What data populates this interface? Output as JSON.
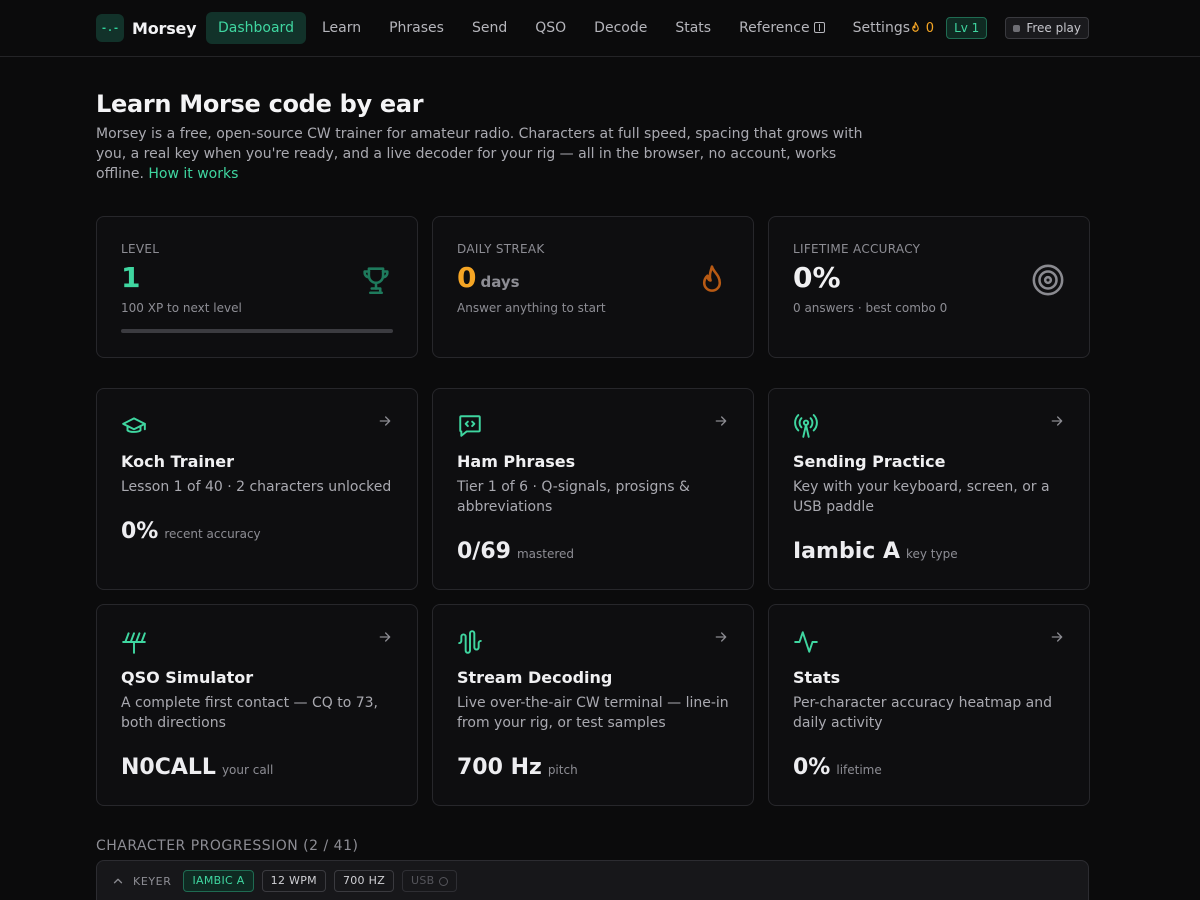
{
  "brand": {
    "logo": "-.-",
    "name": "Morsey"
  },
  "nav": {
    "items": [
      {
        "label": "Dashboard",
        "active": true
      },
      {
        "label": "Learn"
      },
      {
        "label": "Phrases"
      },
      {
        "label": "Send"
      },
      {
        "label": "QSO"
      },
      {
        "label": "Decode"
      },
      {
        "label": "Stats"
      },
      {
        "label": "Reference",
        "icon": "panel-icon"
      },
      {
        "label": "Settings"
      }
    ],
    "streak_count": "0",
    "level_badge": "Lv 1",
    "free_play": "Free play"
  },
  "hero": {
    "title": "Learn Morse code by ear",
    "description": "Morsey is a free, open-source CW trainer for amateur radio. Characters at full speed, spacing that grows with you, a real key when you're ready, and a live decoder for your rig — all in the browser, no account, works offline.",
    "link": "How it works"
  },
  "stats": {
    "level": {
      "label": "LEVEL",
      "value": "1",
      "sub": "100 XP to next level",
      "progress": 0,
      "icon": "trophy-icon"
    },
    "streak": {
      "label": "DAILY STREAK",
      "value": "0",
      "unit": "days",
      "sub": "Answer anything to start",
      "icon": "flame-icon"
    },
    "accuracy": {
      "label": "LIFETIME ACCURACY",
      "value": "0%",
      "sub": "0 answers · best combo 0",
      "icon": "target-icon"
    }
  },
  "features": [
    {
      "title": "Koch Trainer",
      "desc": "Lesson 1 of 40 · 2 characters unlocked",
      "metric": "0%",
      "metric_label": "recent accuracy",
      "icon": "graduation-cap-icon"
    },
    {
      "title": "Ham Phrases",
      "desc": "Tier 1 of 6 · Q-signals, prosigns & abbreviations",
      "metric": "0/69",
      "metric_label": "mastered",
      "icon": "code-message-icon"
    },
    {
      "title": "Sending Practice",
      "desc": "Key with your keyboard, screen, or a USB paddle",
      "metric": "Iambic A",
      "metric_label": "key type",
      "icon": "radio-tower-icon"
    },
    {
      "title": "QSO Simulator",
      "desc": "A complete first contact — CQ to 73, both directions",
      "metric": "N0CALL",
      "metric_label": "your call",
      "icon": "antenna-icon"
    },
    {
      "title": "Stream Decoding",
      "desc": "Live over-the-air CW terminal — line-in from your rig, or test samples",
      "metric": "700 Hz",
      "metric_label": "pitch",
      "icon": "audio-waveform-icon"
    },
    {
      "title": "Stats",
      "desc": "Per-character accuracy heatmap and daily activity",
      "metric": "0%",
      "metric_label": "lifetime",
      "icon": "activity-icon"
    }
  ],
  "progression": {
    "heading": "CHARACTER PROGRESSION (2 / 41)"
  },
  "keyer": {
    "label": "KEYER",
    "mode": "IAMBIC A",
    "speed": "12 WPM",
    "pitch": "700 HZ",
    "usb": "USB"
  },
  "colors": {
    "accent": "#3fd6a0",
    "streak": "#f5a524",
    "background": "#0b0b0c",
    "card": "#0e0e10"
  }
}
